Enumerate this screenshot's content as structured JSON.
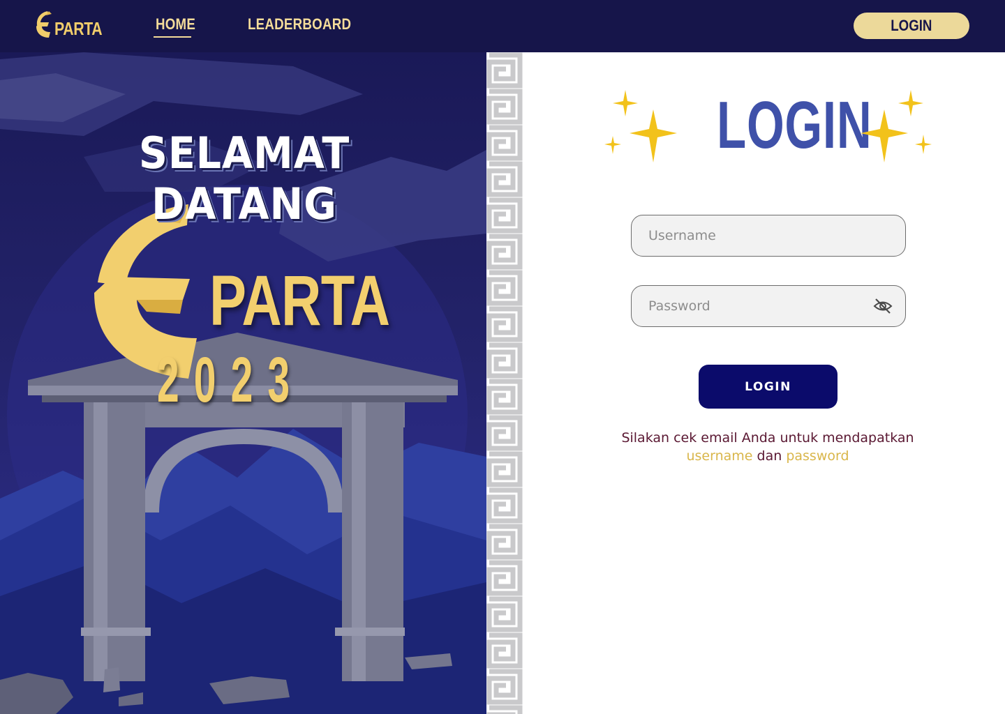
{
  "navbar": {
    "logo_text": "PARTA",
    "links": [
      {
        "label": "HOME",
        "active": true
      },
      {
        "label": "LEADERBOARD",
        "active": false
      }
    ],
    "login_button": "LOGIN"
  },
  "hero": {
    "welcome": "SELAMAT DATANG",
    "brand": "PARTA",
    "year": "2023"
  },
  "login": {
    "title": "LOGIN",
    "username_placeholder": "Username",
    "password_placeholder": "Password",
    "submit_label": "LOGIN",
    "hint_prefix": "Silakan cek email Anda untuk mendapatkan",
    "hint_username": "username",
    "hint_and": "dan",
    "hint_password": "password"
  },
  "colors": {
    "navbar_bg": "#16154a",
    "accent_gold": "#f2cf6e",
    "login_title": "#3f51a9",
    "submit_bg": "#0b0b6b",
    "hint_text": "#5a1832",
    "hint_highlight": "#d9b64a"
  },
  "icons": [
    "spartan-helmet-icon",
    "eye-slash-icon",
    "sparkle-icon"
  ]
}
